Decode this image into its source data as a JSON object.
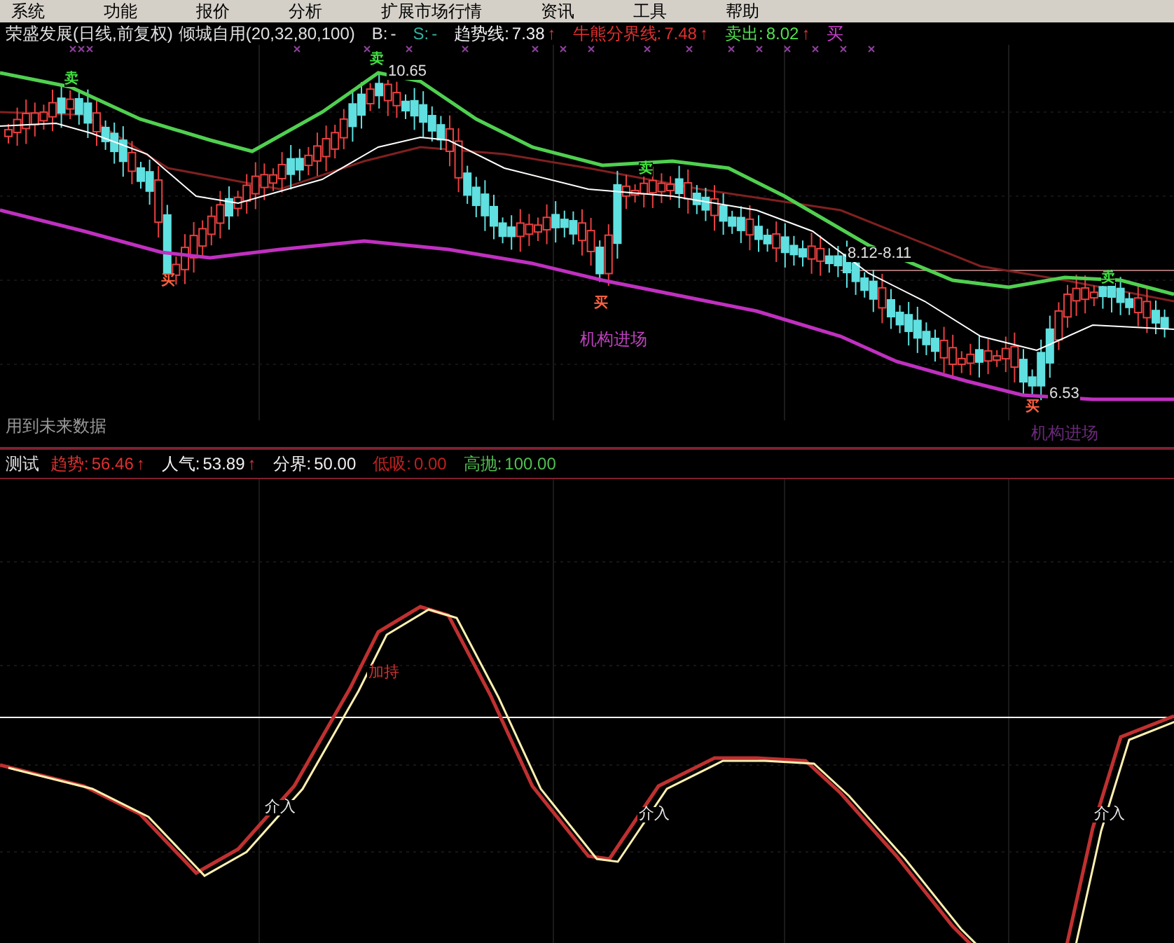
{
  "menu_bar": [
    "系统",
    "功能",
    "报价",
    "分析",
    "扩展市场行情",
    "资讯",
    "工具",
    "帮助"
  ],
  "main_header": {
    "title": "荣盛发展(日线,前复权)",
    "indicator": "倾城自用(20,32,80,100)",
    "items": [
      {
        "label": "B:",
        "value": "-",
        "color": "#e0e0e0"
      },
      {
        "label": "S:",
        "value": "-",
        "color": "#30b0a0"
      },
      {
        "label": "趋势线:",
        "value": "7.38",
        "arrow": "↑",
        "color": "#f0f0f0"
      },
      {
        "label": "牛熊分界线:",
        "value": "7.48",
        "arrow": "↑",
        "color": "#e03030"
      },
      {
        "label": "卖出:",
        "value": "8.02",
        "arrow": "↑",
        "color": "#50e050"
      },
      {
        "label": "买",
        "color": "#d040d0"
      }
    ]
  },
  "main_chart": {
    "price_labels": [
      "10.65",
      "8.12-8.11",
      "6.53"
    ],
    "signals": [
      {
        "kind": "sell",
        "text": "卖"
      },
      {
        "kind": "sell",
        "text": "卖"
      },
      {
        "kind": "sell",
        "text": "卖"
      },
      {
        "kind": "sell",
        "text": "卖"
      },
      {
        "kind": "buy",
        "text": "买"
      },
      {
        "kind": "buy",
        "text": "买"
      },
      {
        "kind": "buy",
        "text": "买"
      }
    ],
    "notes": [
      "机构进场",
      "机构进场"
    ],
    "footer_note": "用到未来数据"
  },
  "lower_header": {
    "title": "测试",
    "items": [
      {
        "label": "趋势:",
        "value": "56.46",
        "arrow": "↑",
        "color": "#e03030"
      },
      {
        "label": "人气:",
        "value": "53.89",
        "arrow": "↑",
        "color": "#f0f0f0"
      },
      {
        "label": "分界:",
        "value": "50.00",
        "color": "#f0f0f0"
      },
      {
        "label": "低吸:",
        "value": "0.00",
        "color": "#c02020"
      },
      {
        "label": "高抛:",
        "value": "100.00",
        "color": "#50c050"
      }
    ]
  },
  "lower_chart": {
    "labels": [
      {
        "kind": "hold",
        "text": "加持"
      },
      {
        "kind": "enter",
        "text": "介入"
      },
      {
        "kind": "enter",
        "text": "介入"
      },
      {
        "kind": "enter",
        "text": "介入"
      }
    ]
  }
}
